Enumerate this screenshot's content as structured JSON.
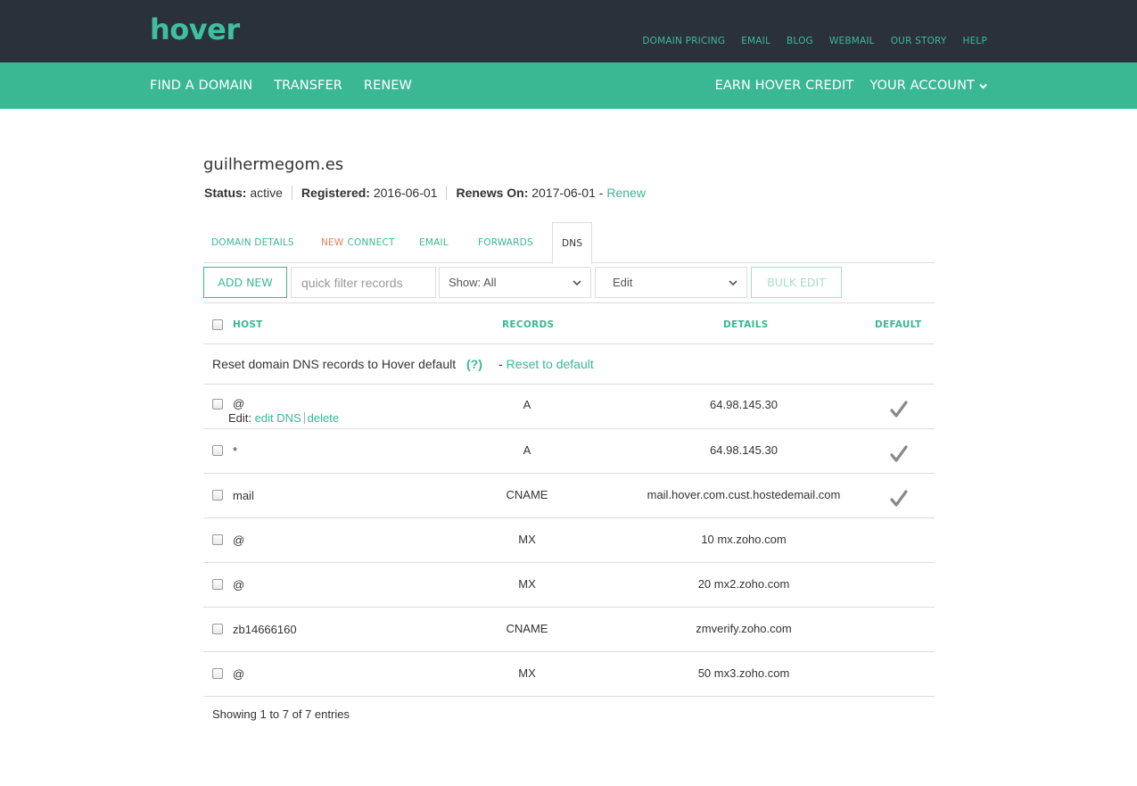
{
  "brand": {
    "logo": "hover",
    "logo_color": "#7bc468",
    "accent": "#3ab894"
  },
  "top_links": [
    "DOMAIN PRICING",
    "EMAIL",
    "BLOG",
    "WEBMAIL",
    "OUR STORY",
    "HELP"
  ],
  "main_nav": {
    "left": [
      "FIND A DOMAIN",
      "TRANSFER",
      "RENEW"
    ],
    "earn_credit": "EARN HOVER CREDIT",
    "account": "YOUR ACCOUNT"
  },
  "domain": {
    "name": "guilhermegom.es",
    "status_label": "Status:",
    "status_value": "active",
    "registered_label": "Registered:",
    "registered_value": "2016-06-01",
    "renews_label": "Renews On:",
    "renews_value": "2017-06-01",
    "renew_sep": "-",
    "renew_link": "Renew"
  },
  "tabs": {
    "domain_details": "DOMAIN DETAILS",
    "new_badge": "NEW",
    "connect": "CONNECT",
    "email": "EMAIL",
    "forwards": "FORWARDS",
    "dns": "DNS",
    "active": "DNS"
  },
  "toolbar": {
    "add_new": "ADD NEW",
    "filter_placeholder": "quick filter records",
    "show_select": "Show: All",
    "edit_select": "Edit",
    "bulk_edit": "BULK EDIT"
  },
  "table": {
    "headers": {
      "host": "HOST",
      "records": "RECORDS",
      "details": "DETAILS",
      "default": "DEFAULT"
    },
    "reset": {
      "text": "Reset domain DNS records to Hover default",
      "help": "(?)",
      "dash": "-",
      "link": "Reset to default"
    },
    "edit_prefix": "Edit:",
    "edit_dns": "edit DNS",
    "delete": "delete",
    "rows": [
      {
        "host": "@",
        "record": "A",
        "details": "64.98.145.30",
        "default": true
      },
      {
        "host": "*",
        "record": "A",
        "details": "64.98.145.30",
        "default": true
      },
      {
        "host": "mail",
        "record": "CNAME",
        "details": "mail.hover.com.cust.hostedemail.com",
        "default": true
      },
      {
        "host": "@",
        "record": "MX",
        "details": "10 mx.zoho.com",
        "default": false
      },
      {
        "host": "@",
        "record": "MX",
        "details": "20 mx2.zoho.com",
        "default": false
      },
      {
        "host": "zb14666160",
        "record": "CNAME",
        "details": "zmverify.zoho.com",
        "default": false
      },
      {
        "host": "@",
        "record": "MX",
        "details": "50 mx3.zoho.com",
        "default": false
      }
    ],
    "showing": "Showing 1 to 7 of 7 entries"
  }
}
